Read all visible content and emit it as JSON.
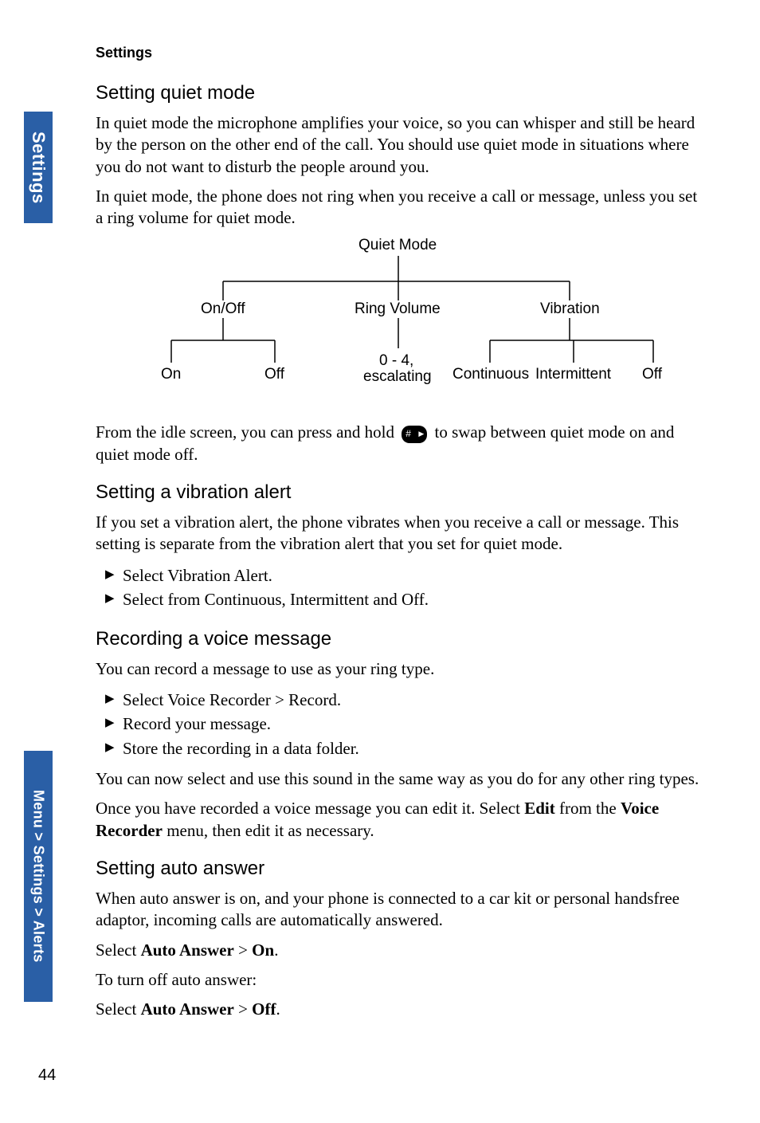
{
  "running_head": "Settings",
  "side_tab_1": "Settings",
  "side_tab_2": "Menu > Settings > Alerts",
  "page_number": "44",
  "sections": {
    "quiet_mode": {
      "title": "Setting quiet mode",
      "p1": "In quiet mode the microphone amplifies your voice, so you can whisper and still be heard by the person on the other end of the call. You should use quiet mode in situations where you do not want to disturb the people around you.",
      "p2": "In quiet mode, the phone does not ring when you receive a call or message, unless you set a ring volume for quiet mode.",
      "after_chart_pre": "From the idle screen, you can press and hold ",
      "after_chart_post": " to swap between quiet mode on and quiet mode off."
    },
    "vibration": {
      "title": "Setting a vibration alert",
      "p1": "If you set a vibration alert, the phone vibrates when you receive a call or message. This setting is separate from the vibration alert that you set for quiet mode.",
      "li1_pre": "Select ",
      "li1_b": "Vibration Alert",
      "li1_post": ".",
      "li2_pre": "Select from ",
      "li2_b1": "Continuous",
      "li2_mid1": ", ",
      "li2_b2": "Intermittent",
      "li2_mid2": " and ",
      "li2_b3": "Off",
      "li2_post": "."
    },
    "recording": {
      "title": "Recording a voice message",
      "p1": "You can record a message to use as your ring type.",
      "li1_pre": "Select ",
      "li1_b1": "Voice Recorder",
      "li1_mid": " > ",
      "li1_b2": "Record",
      "li1_post": ".",
      "li2": "Record your message.",
      "li3": "Store the recording in a data folder.",
      "p2": "You can now select and use this sound in the same way as you do for any other ring types.",
      "p3_pre": "Once you have recorded a voice message you can edit it. Select ",
      "p3_b1": "Edit",
      "p3_mid": " from the ",
      "p3_b2": "Voice Recorder",
      "p3_post": " menu, then edit it as necessary."
    },
    "auto_answer": {
      "title": "Setting auto answer",
      "p1": "When auto answer is on, and your phone is connected to a car kit or personal handsfree adaptor, incoming calls are automatically answered.",
      "p2_pre": "Select ",
      "p2_b1": "Auto Answer",
      "p2_mid": " > ",
      "p2_b2": "On",
      "p2_post": ".",
      "p3": "To turn off auto answer:",
      "p4_pre": "Select ",
      "p4_b1": "Auto Answer",
      "p4_mid": " > ",
      "p4_b2": "Off",
      "p4_post": "."
    }
  },
  "chart_data": {
    "type": "tree",
    "root": "Quiet Mode",
    "children": [
      {
        "label": "On/Off",
        "children": [
          "On",
          "Off"
        ]
      },
      {
        "label": "Ring Volume",
        "children": [
          "0 - 4, escalating"
        ]
      },
      {
        "label": "Vibration",
        "children": [
          "Continuous",
          "Intermittent",
          "Off"
        ]
      }
    ],
    "nodes": {
      "root": "Quiet Mode",
      "onoff": "On/Off",
      "ringvol": "Ring Volume",
      "vibration": "Vibration",
      "on": "On",
      "off": "Off",
      "range_l1": "0 - 4,",
      "range_l2": "escalating",
      "continuous": "Continuous",
      "intermittent": "Intermittent",
      "voff": "Off"
    }
  }
}
